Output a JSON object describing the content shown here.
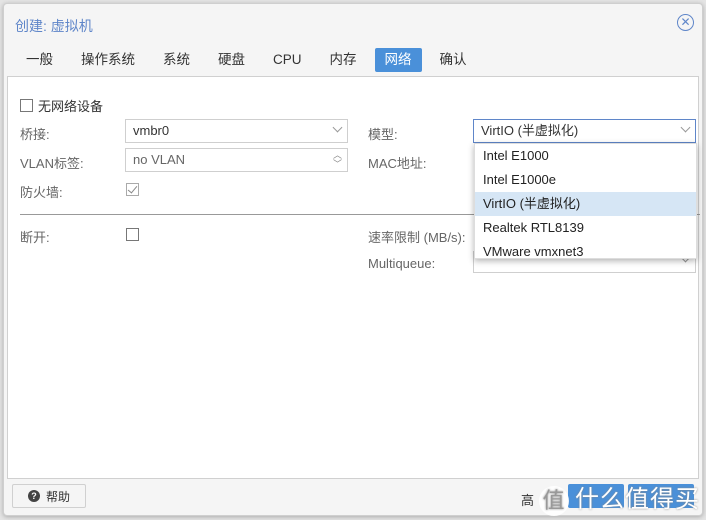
{
  "window": {
    "title": "创建: 虚拟机"
  },
  "tabs": [
    {
      "label": "一般",
      "active": false
    },
    {
      "label": "操作系统",
      "active": false
    },
    {
      "label": "系统",
      "active": false
    },
    {
      "label": "硬盘",
      "active": false
    },
    {
      "label": "CPU",
      "active": false
    },
    {
      "label": "内存",
      "active": false
    },
    {
      "label": "网络",
      "active": true
    },
    {
      "label": "确认",
      "active": false
    }
  ],
  "form": {
    "no_network": {
      "label": "无网络设备",
      "checked": false
    },
    "bridge": {
      "label": "桥接:",
      "value": "vmbr0"
    },
    "vlan": {
      "label": "VLAN标签:",
      "value": "no VLAN"
    },
    "firewall": {
      "label": "防火墙:",
      "checked": true
    },
    "disconnect": {
      "label": "断开:",
      "checked": false
    },
    "model": {
      "label": "模型:",
      "value": "VirtIO (半虚拟化)"
    },
    "mac": {
      "label": "MAC地址:"
    },
    "rate_limit": {
      "label": "速率限制 (MB/s):"
    },
    "multiqueue": {
      "label": "Multiqueue:"
    }
  },
  "model_dropdown": {
    "options": [
      "Intel E1000",
      "Intel E1000e",
      "VirtIO (半虚拟化)",
      "Realtek RTL8139",
      "VMware vmxnet3"
    ],
    "selected": "VirtIO (半虚拟化)"
  },
  "footer": {
    "help_label": "帮助",
    "advanced_label": "高",
    "watermark_icon": "值",
    "watermark_text": "什么值得买"
  },
  "icons": {
    "close": "⊗",
    "help": "?"
  }
}
